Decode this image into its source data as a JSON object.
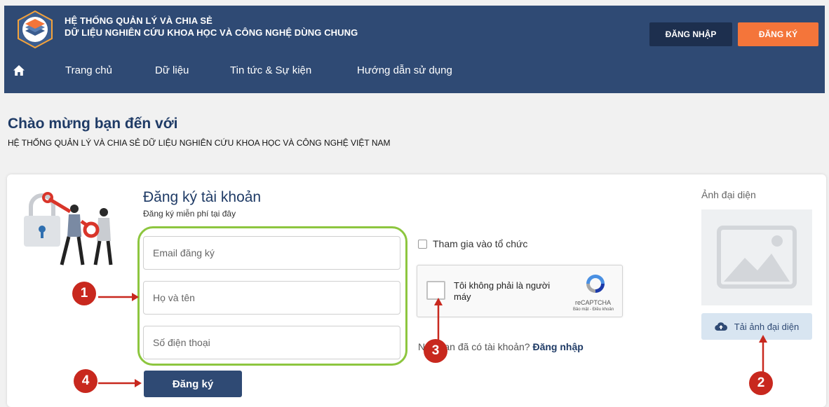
{
  "header": {
    "brand_line1": "HỆ THỐNG QUẢN LÝ VÀ CHIA SẺ",
    "brand_line2": "DỮ LIỆU NGHIÊN CỨU KHOA HỌC VÀ CÔNG NGHỆ DÙNG CHUNG",
    "login_label": "ĐĂNG NHẬP",
    "register_label": "ĐĂNG KÝ",
    "logo_icon": "layers-logo-icon"
  },
  "nav": {
    "home_icon": "home-icon",
    "items": [
      {
        "label": "Trang chủ"
      },
      {
        "label": "Dữ liệu"
      },
      {
        "label": "Tin tức & Sự kiện"
      },
      {
        "label": "Hướng dẫn sử dụng"
      }
    ]
  },
  "welcome": {
    "title": "Chào mừng bạn đến với",
    "subtitle": "HỆ THỐNG QUẢN LÝ VÀ CHIA SẺ DỮ LIỆU NGHIÊN CỨU KHOA HỌC VÀ CÔNG NGHỆ VIỆT NAM"
  },
  "form": {
    "title": "Đăng ký tài khoản",
    "subtitle": "Đăng ký miễn phí tại đây",
    "email_placeholder": "Email đăng ký",
    "name_placeholder": "Họ và tên",
    "phone_placeholder": "Số điện thoại",
    "org_label": "Tham gia vào tổ chức",
    "org_checked": false,
    "recaptcha_text": "Tôi không phải là người máy",
    "recaptcha_brand": "reCAPTCHA",
    "recaptcha_links": "Bảo mật - Điều khoản",
    "already_prefix": "Nếu bạn đã có tài khoản?",
    "already_link": "Đăng nhập",
    "submit_label": "Đăng ký"
  },
  "avatar": {
    "label": "Ảnh đại diện",
    "upload_label": "Tải ảnh đại diện",
    "placeholder_icon": "image-placeholder-icon",
    "upload_icon": "cloud-upload-icon"
  },
  "markers": [
    "1",
    "2",
    "3",
    "4"
  ],
  "colors": {
    "header_bg": "#2f4a74",
    "register_accent": "#f4753a",
    "marker_red": "#c8281e",
    "highlight_green": "#8dc63f"
  }
}
